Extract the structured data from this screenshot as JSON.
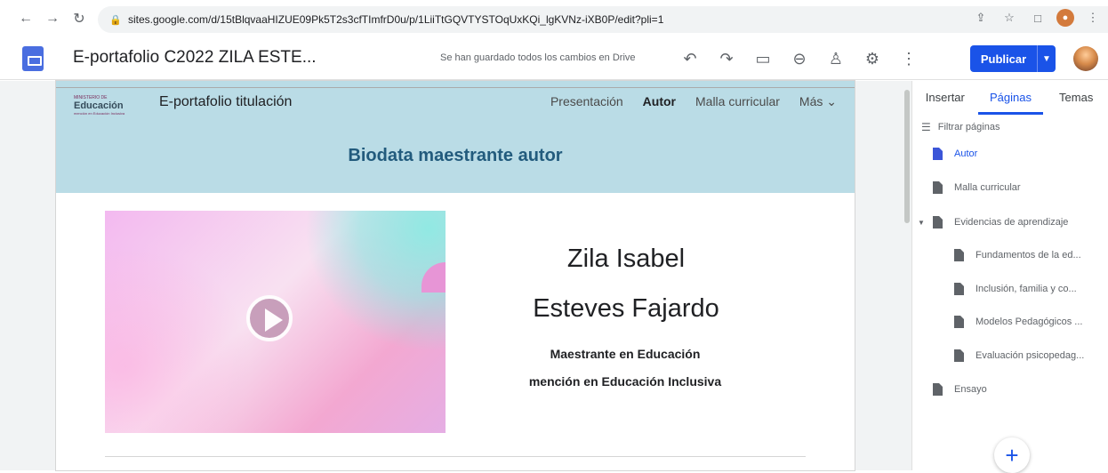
{
  "browser": {
    "url": "sites.google.com/d/15tBlqvaaHIZUE09Pk5T2s3cfTImfrD0u/p/1LiiTtGQVTYSTOqUxKQi_lgKVNz-iXB0P/edit?pli=1"
  },
  "toolbar": {
    "site_title": "E-portafolio C2022 ZILA ESTE...",
    "saved_status": "Se han guardado todos los cambios en Drive",
    "publish_label": "Publicar"
  },
  "site": {
    "logo_top": "MINISTERIO DE",
    "logo_main": "Educación",
    "logo_sub": "mención en Educación Inclusiva",
    "name": "E-portafolio titulación",
    "nav": [
      "Presentación",
      "Autor",
      "Malla curricular",
      "Más"
    ],
    "heading": "Biodata maestrante autor",
    "person_name": [
      "Zila Isabel",
      "Esteves Fajardo"
    ],
    "role": [
      "Maestrante en Educación",
      "mención en Educación Inclusiva"
    ]
  },
  "panel": {
    "tabs": [
      "Insertar",
      "Páginas",
      "Temas"
    ],
    "filter_placeholder": "Filtrar páginas",
    "pages": [
      {
        "label": "Autor"
      },
      {
        "label": "Malla curricular"
      },
      {
        "label": "Evidencias de aprendizaje"
      },
      {
        "label": "Fundamentos de la ed..."
      },
      {
        "label": "Inclusión, familia y co..."
      },
      {
        "label": "Modelos Pedagógicos ..."
      },
      {
        "label": "Evaluación psicopedag..."
      },
      {
        "label": "Ensayo"
      }
    ],
    "add_symbol": "+"
  },
  "colors": {
    "accent": "#1a53e8",
    "header_band": "#badce6",
    "heading_text": "#225b7d"
  },
  "icons": {
    "back": "back-arrow-icon",
    "forward": "forward-arrow-icon",
    "refresh": "refresh-icon",
    "lock": "lock-icon",
    "undo": "undo-icon",
    "redo": "redo-icon",
    "preview": "device-preview-icon",
    "link": "link-icon",
    "share": "add-person-icon",
    "settings": "gear-icon",
    "more": "more-vertical-icon"
  }
}
